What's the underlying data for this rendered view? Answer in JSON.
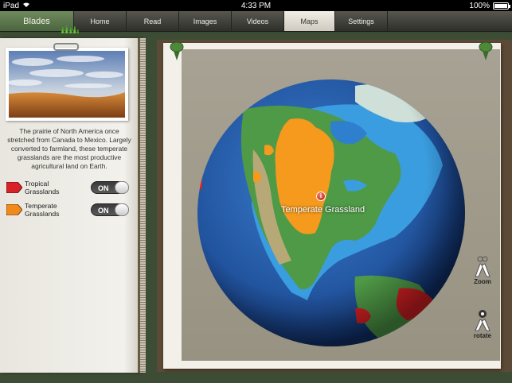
{
  "status_bar": {
    "device": "iPad",
    "time": "4:33 PM",
    "battery": "100%"
  },
  "nav": {
    "brand": "Blades",
    "tabs": [
      {
        "label": "Home",
        "active": false
      },
      {
        "label": "Read",
        "active": false
      },
      {
        "label": "Images",
        "active": false
      },
      {
        "label": "Videos",
        "active": false
      },
      {
        "label": "Maps",
        "active": true
      },
      {
        "label": "Settings",
        "active": false
      }
    ]
  },
  "sidebar": {
    "description": "The prairie of North America once stretched from Canada to Mexico. Largely converted to farmland, these temperate grasslands are the most productive agricultural land on Earth.",
    "legend": [
      {
        "label_line1": "Tropical",
        "label_line2": "Grasslands",
        "color": "#d8222a",
        "toggle": "ON"
      },
      {
        "label_line1": "Temperate",
        "label_line2": "Grasslands",
        "color": "#f08a1c",
        "toggle": "ON"
      }
    ]
  },
  "map": {
    "marker_icon": "info-icon",
    "marker_glyph": "i",
    "label": "Temperate Grassland",
    "colors": {
      "ocean": "#2a63b5",
      "shallow": "#3fa0e0",
      "land": "#4f9a47",
      "temperate": "#f59a1d",
      "tropical": "#d82024"
    }
  },
  "controls": {
    "zoom_label": "Zoom",
    "rotate_label": "rotate"
  }
}
